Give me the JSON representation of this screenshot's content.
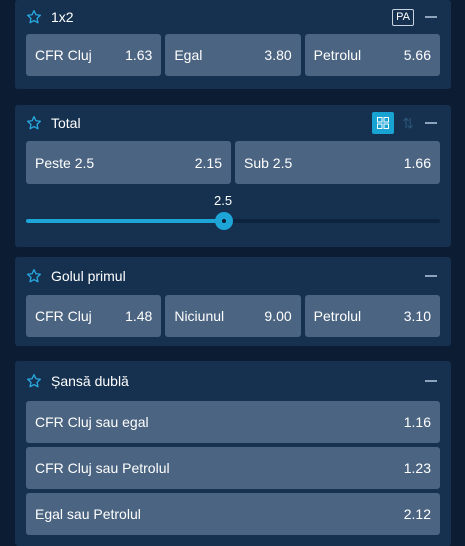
{
  "markets": {
    "m1x2": {
      "title": "1x2",
      "badge": "PA",
      "outcomes": [
        {
          "label": "CFR Cluj",
          "odds": "1.63"
        },
        {
          "label": "Egal",
          "odds": "3.80"
        },
        {
          "label": "Petrolul",
          "odds": "5.66"
        }
      ]
    },
    "total": {
      "title": "Total",
      "outcomes": [
        {
          "label": "Peste 2.5",
          "odds": "2.15"
        },
        {
          "label": "Sub 2.5",
          "odds": "1.66"
        }
      ],
      "slider_value": "2.5"
    },
    "first_goal": {
      "title": "Golul primul",
      "outcomes": [
        {
          "label": "CFR Cluj",
          "odds": "1.48"
        },
        {
          "label": "Niciunul",
          "odds": "9.00"
        },
        {
          "label": "Petrolul",
          "odds": "3.10"
        }
      ]
    },
    "double_chance": {
      "title": "Șansă dublă",
      "outcomes": [
        {
          "label": "CFR Cluj sau egal",
          "odds": "1.16"
        },
        {
          "label": "CFR Cluj sau Petrolul",
          "odds": "1.23"
        },
        {
          "label": "Egal sau Petrolul",
          "odds": "2.12"
        }
      ]
    }
  },
  "icons": {
    "star": "star-outline-icon",
    "collapse": "minus-icon",
    "grid": "grid-view-icon",
    "sort": "sort-icon"
  },
  "colors": {
    "page_bg": "#0b1c33",
    "panel_bg": "#15314f",
    "button_bg": "#4b6481",
    "accent": "#1ca5d6",
    "star": "#29a8e0"
  }
}
